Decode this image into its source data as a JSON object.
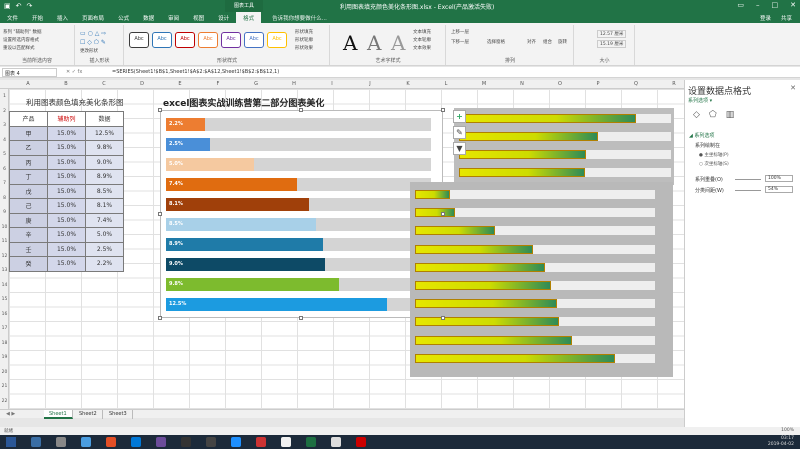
{
  "window": {
    "context_tab": "图表工具",
    "doc_title": "利用图表填充颜色美化条形图.xlsx - Excel(产品激活失败)",
    "user": "登录",
    "share": "共享"
  },
  "ribbon_tabs": [
    "文件",
    "开始",
    "插入",
    "页面布局",
    "公式",
    "数据",
    "审阅",
    "视图",
    "设计",
    "格式"
  ],
  "active_tab": "格式",
  "search_hint": "告诉我你想要做什么...",
  "ribbon": {
    "g1_items": [
      "系列 \"辅助列\" 数据",
      "设置所选内容格式",
      "重设以匹配样式"
    ],
    "g1_label": "当前所选内容",
    "g2_label": "插入形状",
    "g2_change": "更改形状",
    "style_sample": "Abc",
    "style_colors": [
      "#3c3c3c",
      "#2e75b6",
      "#c00000",
      "#ed7d31",
      "#7030a0",
      "#4472c4",
      "#ffc000"
    ],
    "g3_label": "形状样式",
    "g3_items": [
      "形状填充",
      "形状轮廓",
      "形状效果"
    ],
    "wordart_letters": [
      "A",
      "A",
      "A"
    ],
    "wordart_label": "艺术字样式",
    "wordart_items": [
      "文本填充",
      "文本轮廓",
      "文本效果"
    ],
    "arrange_items": [
      "上移一层",
      "下移一层",
      "选择窗格",
      "对齐",
      "组合",
      "旋转"
    ],
    "arrange_label": "排列",
    "size_values": [
      "12.57 厘米",
      "15.19 厘米"
    ],
    "size_label": "大小"
  },
  "formula_bar": {
    "name_box": "图表 4",
    "fx": "✕ ✓ fx",
    "formula": "=SERIES(Sheet1!$B$1,Sheet1!$A$2:$A$12,Sheet1!$B$2:$B$12,1)"
  },
  "columns": [
    "A",
    "B",
    "C",
    "D",
    "E",
    "F",
    "G",
    "H",
    "I",
    "J",
    "K",
    "L",
    "M",
    "N",
    "O",
    "P",
    "Q",
    "R"
  ],
  "rows": [
    "1",
    "2",
    "3",
    "4",
    "5",
    "6",
    "7",
    "8",
    "9",
    "10",
    "11",
    "12",
    "13",
    "14",
    "15",
    "16",
    "17",
    "18",
    "19",
    "20",
    "21",
    "22"
  ],
  "sheet_title_1": "利用图表颜色填充美化条形图",
  "sheet_title_2": "excel图表实战训练营第二部分图表美化",
  "table": {
    "headers": [
      "产品",
      "辅助列",
      "数据"
    ],
    "rows": [
      [
        "甲",
        "15.0%",
        "12.5%"
      ],
      [
        "乙",
        "15.0%",
        "9.8%"
      ],
      [
        "丙",
        "15.0%",
        "9.0%"
      ],
      [
        "丁",
        "15.0%",
        "8.9%"
      ],
      [
        "戊",
        "15.0%",
        "8.5%"
      ],
      [
        "己",
        "15.0%",
        "8.1%"
      ],
      [
        "庚",
        "15.0%",
        "7.4%"
      ],
      [
        "辛",
        "15.0%",
        "5.0%"
      ],
      [
        "壬",
        "15.0%",
        "2.5%"
      ],
      [
        "癸",
        "15.0%",
        "2.2%"
      ]
    ]
  },
  "chart_data": [
    {
      "type": "bar",
      "title": "",
      "categories": [
        "癸",
        "壬",
        "辛",
        "庚",
        "己",
        "戊",
        "丁",
        "丙",
        "乙",
        "甲"
      ],
      "series": [
        {
          "name": "辅助列",
          "values": [
            15.0,
            15.0,
            15.0,
            15.0,
            15.0,
            15.0,
            15.0,
            15.0,
            15.0,
            15.0
          ]
        },
        {
          "name": "数据",
          "values": [
            2.2,
            2.5,
            5.0,
            7.4,
            8.1,
            8.5,
            8.9,
            9.0,
            9.8,
            12.5
          ]
        }
      ],
      "labels": [
        "2.2%",
        "2.5%",
        "5.0%",
        "7.4%",
        "8.1%",
        "8.5%",
        "8.9%",
        "9.0%",
        "9.8%",
        "12.5%"
      ],
      "bar_colors": [
        "#ed7d31",
        "#4a8fd8",
        "#f5c9a0",
        "#e06c10",
        "#a0400a",
        "#a8d0e8",
        "#1f7ba8",
        "#0d4a66",
        "#7dbb2e",
        "#1c9be0"
      ],
      "track_color": "#d4d4d4",
      "xlim": [
        0,
        15
      ]
    },
    {
      "type": "bar",
      "title": "",
      "categories": [
        "1",
        "2",
        "3",
        "4",
        "5",
        "6",
        "7",
        "8",
        "9",
        "10"
      ],
      "series": [
        {
          "name": "辅助列",
          "values": [
            15,
            15,
            15,
            15,
            15,
            15,
            15,
            15,
            15,
            15
          ]
        },
        {
          "name": "数据",
          "values": [
            2.2,
            2.5,
            5.0,
            7.4,
            8.1,
            8.5,
            8.9,
            9.0,
            9.8,
            12.5
          ]
        }
      ],
      "xlim": [
        0,
        15
      ]
    }
  ],
  "chart3_fills": [
    12.5,
    9.8,
    9.0,
    8.9
  ],
  "pane": {
    "title": "设置数据点格式",
    "subtitle": "系列选项 ▾",
    "section": "◢ 系列选项",
    "axis_label": "系列绘制在",
    "axis_options": [
      "● 主坐标轴(P)",
      "○ 次坐标轴(S)"
    ],
    "overlap_label": "系列重叠(O)",
    "overlap_value": "100%",
    "gap_label": "分类间距(W)",
    "gap_value": "54%"
  },
  "sheets": [
    "Sheet1",
    "Sheet2",
    "Sheet3"
  ],
  "active_sheet": "Sheet1",
  "status": {
    "ready": "就绪",
    "zoom": "100%"
  },
  "clock": {
    "time": "03:17",
    "date": "2019-04-02"
  },
  "taskbar_colors": [
    "#2b5797",
    "#3a6ea5",
    "#888",
    "#4a9de0",
    "#e34f26",
    "#0078d7",
    "#6b4c9a",
    "#333",
    "#444",
    "#1e90ff",
    "#cc3333",
    "#f0f0f0",
    "#1d6f42",
    "#ddd",
    "#c00"
  ]
}
